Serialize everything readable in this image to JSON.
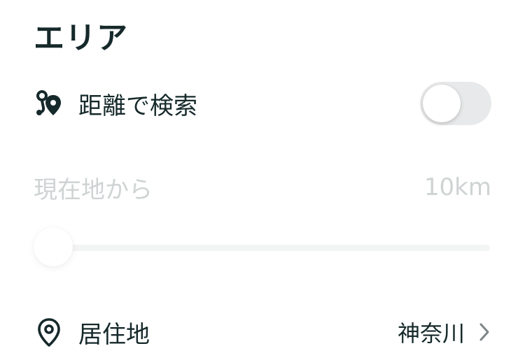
{
  "area": {
    "title": "エリア"
  },
  "distance_search": {
    "icon": "distance-pins-icon",
    "label": "距離で検索",
    "toggle_on": false
  },
  "from_current": {
    "label": "現在地から",
    "value": "10km"
  },
  "distance_slider": {
    "level": 0
  },
  "residence": {
    "icon": "location-pin-icon",
    "label": "居住地",
    "value": "神奈川"
  },
  "colors": {
    "text_primary": "#16292b",
    "text_disabled": "#cfd3d4",
    "toggle_off_bg": "#e8e9ea",
    "slider_track": "#f3f4f4",
    "chevron": "#7d8586"
  }
}
